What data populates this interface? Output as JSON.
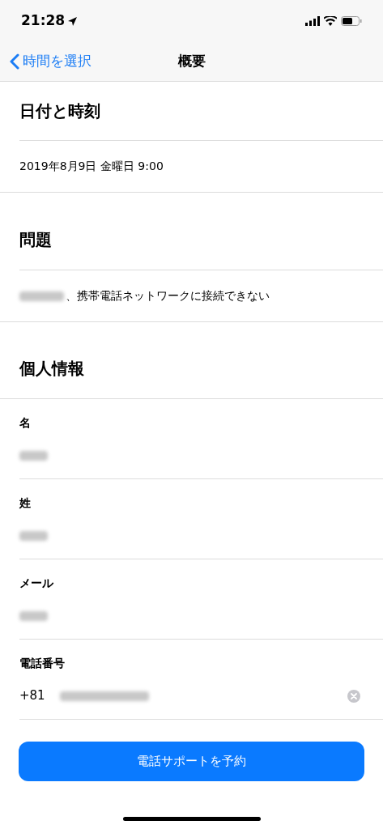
{
  "status_bar": {
    "time": "21:28"
  },
  "nav": {
    "back": "時間を選択",
    "title": "概要"
  },
  "sections": [
    {
      "title": "日付と時刻",
      "row": {
        "kind": "plain",
        "text": "2019年8月9日 金曜日 9:00"
      }
    },
    {
      "title": "問題",
      "row": {
        "kind": "blurred_prefix",
        "text": "、携帯電話ネットワークに接続できない"
      }
    }
  ],
  "personal": {
    "title": "個人情報",
    "fields": [
      {
        "label": "名",
        "value_blurred": true,
        "clearable": false
      },
      {
        "label": "姓",
        "value_blurred": true,
        "clearable": false
      },
      {
        "label": "メール",
        "value_blurred": true,
        "clearable": false
      },
      {
        "label": "電話番号",
        "prefix": "+81",
        "value_blurred": true,
        "clearable": true
      }
    ]
  },
  "button": "電話サポートを予約"
}
